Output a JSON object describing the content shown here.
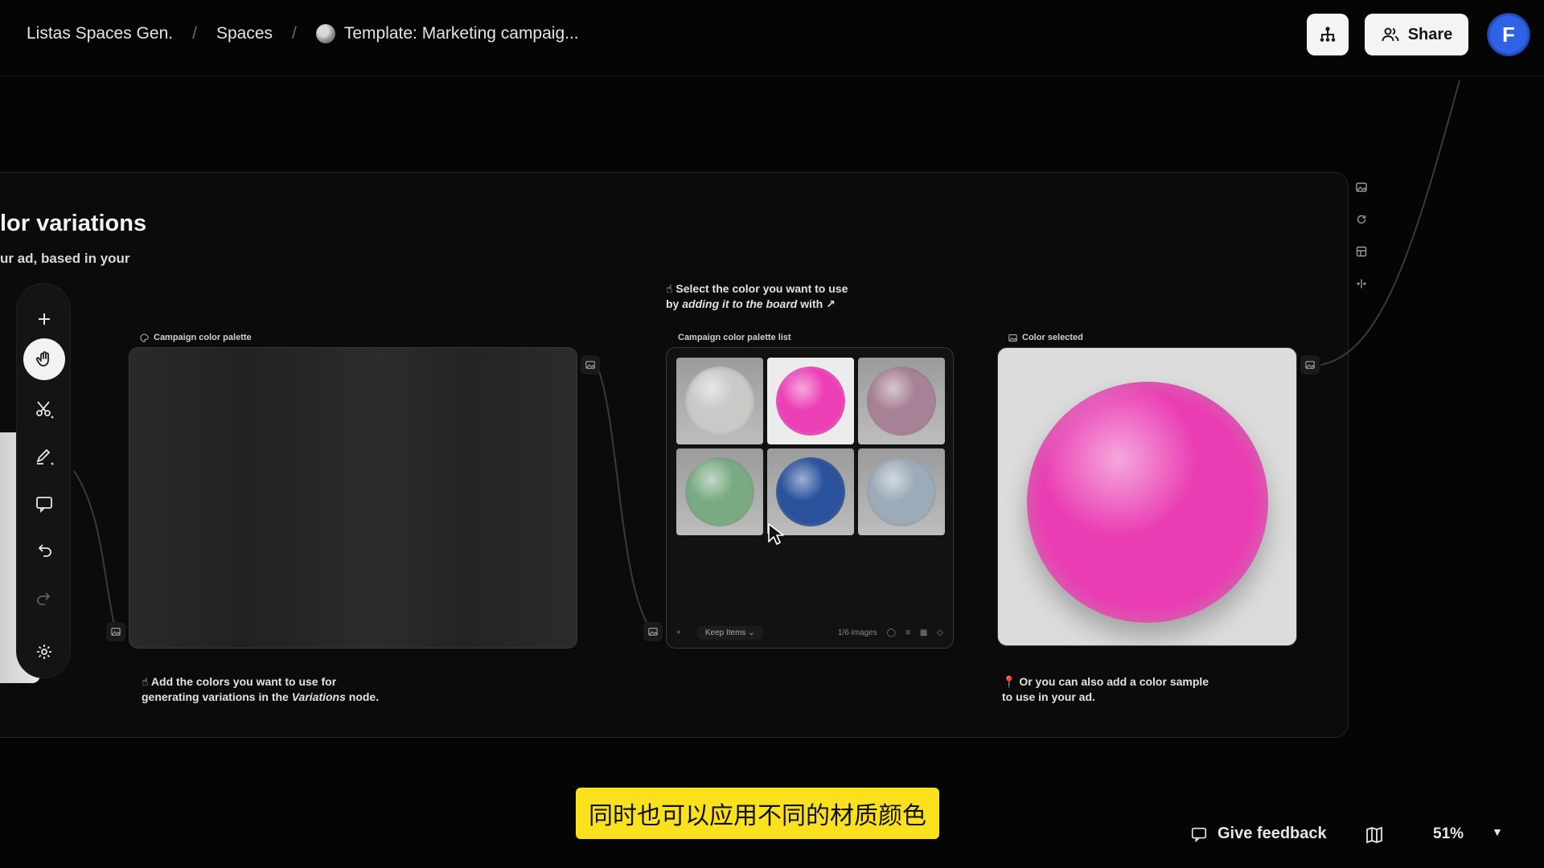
{
  "breadcrumb": {
    "items": [
      "Listas Spaces Gen.",
      "Spaces",
      "Template: Marketing campaig..."
    ],
    "separator": "/"
  },
  "header": {
    "share_label": "Share",
    "avatar_letter": "F"
  },
  "group": {
    "title": "lor variations",
    "subtitle": "ur ad, based in your"
  },
  "nodes": {
    "palette": {
      "label": "Campaign color palette"
    },
    "list": {
      "label": "Campaign color palette list",
      "keep_label": "Keep Items",
      "count_label": "1/6 images",
      "swatches": [
        {
          "name": "white",
          "color": "#c9cac6"
        },
        {
          "name": "pink",
          "color": "#ec3fb6"
        },
        {
          "name": "dusty-pink",
          "color": "#b07e98"
        },
        {
          "name": "green",
          "color": "#6fae79"
        },
        {
          "name": "blue",
          "color": "#1d52b6"
        },
        {
          "name": "light-blue",
          "color": "#98acbd"
        }
      ],
      "selected_index": 1
    },
    "selected": {
      "label": "Color selected",
      "color": "#ea3db3"
    }
  },
  "hints": {
    "select": {
      "line1": "Select the color you want to use",
      "line2_prefix": "by",
      "line2_em": "adding it to the board",
      "line2_suffix": "with ↗"
    },
    "palette": {
      "line1": "Add the colors you want to use for",
      "line2_prefix": "generating variations in the",
      "line2_em": "Variations",
      "line2_suffix": "node."
    },
    "sample": {
      "line1": "Or you can also add a color sample",
      "line2": "to use in your ad."
    }
  },
  "subtitle_caption": "同时也可以应用不同的材质颜色",
  "footer": {
    "feedback_label": "Give feedback",
    "zoom_label": "51%"
  }
}
